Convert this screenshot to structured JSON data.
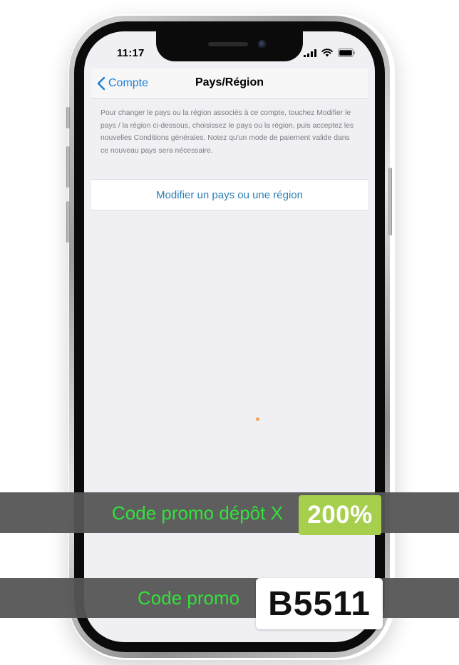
{
  "status_bar": {
    "time": "11:17",
    "icons": [
      "signal-icon",
      "wifi-icon",
      "battery-icon"
    ]
  },
  "nav": {
    "back_label": "Compte",
    "title": "Pays/Région"
  },
  "description": "Pour changer le pays ou la région associés à ce compte, touchez Modifier le pays / la région ci-dessous, choisissez le pays ou la région, puis acceptez les nouvelles Conditions générales. Notez qu'un mode de paiement valide dans ce nouveau pays sera nécessaire.",
  "action": {
    "label": "Modifier un pays ou une région"
  },
  "promo": {
    "line1": "Code promo dépôt X",
    "percent": "200%",
    "line2": "Code promo",
    "code": "B5511"
  },
  "colors": {
    "ios_blue": "#1a7fd5",
    "promo_green": "#31e23a",
    "badge_green": "#a6cf4e",
    "band_gray": "#555555"
  }
}
